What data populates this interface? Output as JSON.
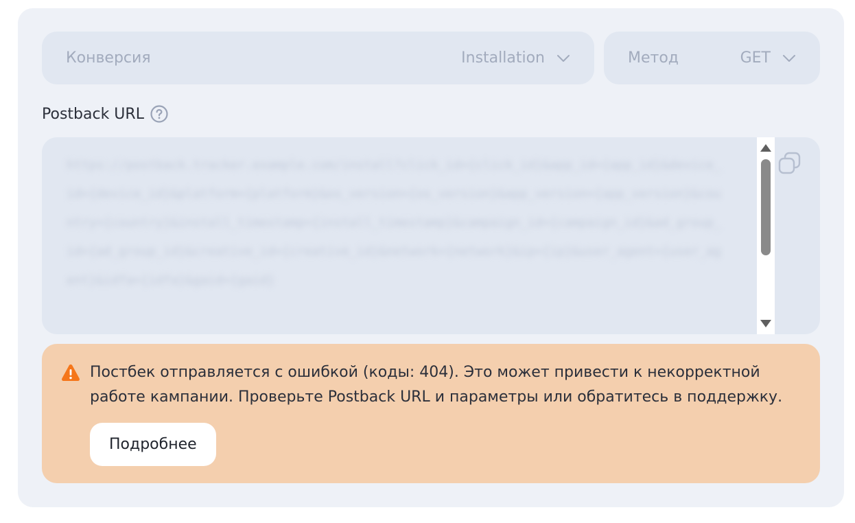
{
  "conversion": {
    "label": "Конверсия",
    "value": "Installation",
    "icon": "chevron-down-icon"
  },
  "method": {
    "label": "Метод",
    "value": "GET",
    "icon": "chevron-down-icon"
  },
  "postback": {
    "title": "Postback URL",
    "help_icon": "question-circle-icon",
    "url_text": "https://postback.tracker.example.com/install?click_id={click_id}&app_id={app_id}&device_id={device_id}&platform={platform}&os_version={os_version}&app_version={app_version}&country={country}&install_timestamp={install_timestamp}&campaign_id={campaign_id}&ad_group_id={ad_group_id}&creative_id={creative_id}&network={network}&ip={ip}&user_agent={user_agent}&idfa={idfa}&gaid={gaid}",
    "copy_icon": "copy-icon"
  },
  "alert": {
    "icon": "warning-triangle-icon",
    "message": "Постбек отправляется с ошибкой (коды: 404). Это может привести к некорректной работе кампании. Проверьте Postback URL и параметры или обратитесь в поддержку.",
    "button_label": "Подробнее"
  },
  "colors": {
    "card_bg": "#eef1f7",
    "field_bg": "#e1e7f1",
    "muted_text": "#a2abbd",
    "alert_bg": "#f4cfae",
    "warning": "#f5761a"
  }
}
